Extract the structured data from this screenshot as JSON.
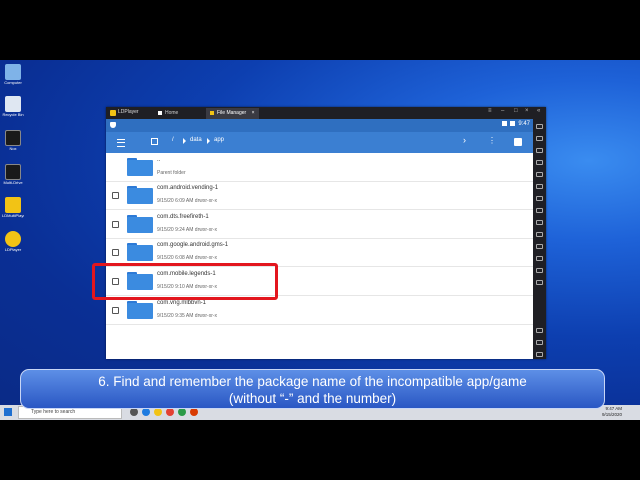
{
  "desktop": {
    "icons": [
      {
        "label": "Computer",
        "color": "#7fb3e8"
      },
      {
        "label": "Recycle Bin",
        "color": "#dfe7f2"
      },
      {
        "label": "Nox",
        "color": "#1a1a1a"
      },
      {
        "label": "Multi-Drive",
        "color": "#1a1a1a"
      },
      {
        "label": "LDMultiPlayer",
        "color": "#f2c315"
      },
      {
        "label": "LDPlayer",
        "color": "#f2c315"
      }
    ]
  },
  "emulator": {
    "app_name": "LDPlayer",
    "tabs": [
      {
        "label": "Home",
        "active": false
      },
      {
        "label": "File Manager",
        "active": true
      }
    ],
    "status_time": "9:47",
    "breadcrumb": [
      "/",
      "data",
      "app"
    ],
    "rows": [
      {
        "name": "..",
        "meta": "Parent folder",
        "checkbox": false
      },
      {
        "name": "com.android.vending-1",
        "meta": "9/15/20 6:09 AM  drwxr-xr-x",
        "checkbox": true
      },
      {
        "name": "com.dts.freefireth-1",
        "meta": "9/15/20 9:24 AM  drwxr-xr-x",
        "checkbox": true
      },
      {
        "name": "com.google.android.gms-1",
        "meta": "9/15/20 6:08 AM  drwxr-xr-x",
        "checkbox": true
      },
      {
        "name": "com.mobile.legends-1",
        "meta": "9/15/20 9:10 AM  drwxr-xr-x",
        "checkbox": true
      },
      {
        "name": "com.vng.mlbbvn-1",
        "meta": "9/15/20 9:35 AM  drwxr-xr-x",
        "checkbox": true
      }
    ]
  },
  "caption": {
    "line1": "6. Find and remember the package name of the incompatible app/game",
    "line2": "(without “-” and the number)"
  },
  "taskbar": {
    "search_placeholder": "Type here to search",
    "clock_time": "9:47 AM",
    "clock_date": "9/15/2020"
  },
  "colors": {
    "highlight": "#e3161e",
    "appbar": "#3b7fd2",
    "folder": "#3b8be0"
  }
}
